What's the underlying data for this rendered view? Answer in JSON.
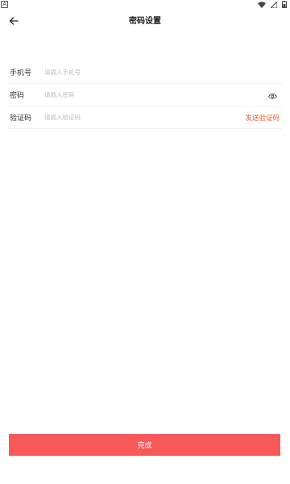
{
  "status_bar": {
    "left_icon_glyph": "A",
    "icons": [
      "wifi-icon",
      "signal-icon",
      "battery-icon"
    ]
  },
  "header": {
    "back_icon": "arrow-left-icon",
    "title": "密码设置"
  },
  "form": {
    "phone": {
      "label": "手机号",
      "placeholder": "请输入手机号",
      "value": ""
    },
    "password": {
      "label": "密码",
      "placeholder": "请输入密码",
      "value": "",
      "toggle_icon": "eye-icon"
    },
    "code": {
      "label": "验证码",
      "placeholder": "请输入验证码",
      "value": "",
      "send_label": "发送验证码"
    }
  },
  "submit": {
    "label": "完成"
  },
  "colors": {
    "accent": "#f75858",
    "send_code": "#e95a2e",
    "placeholder": "#bcbcbc",
    "divider": "#f0f0f0"
  }
}
